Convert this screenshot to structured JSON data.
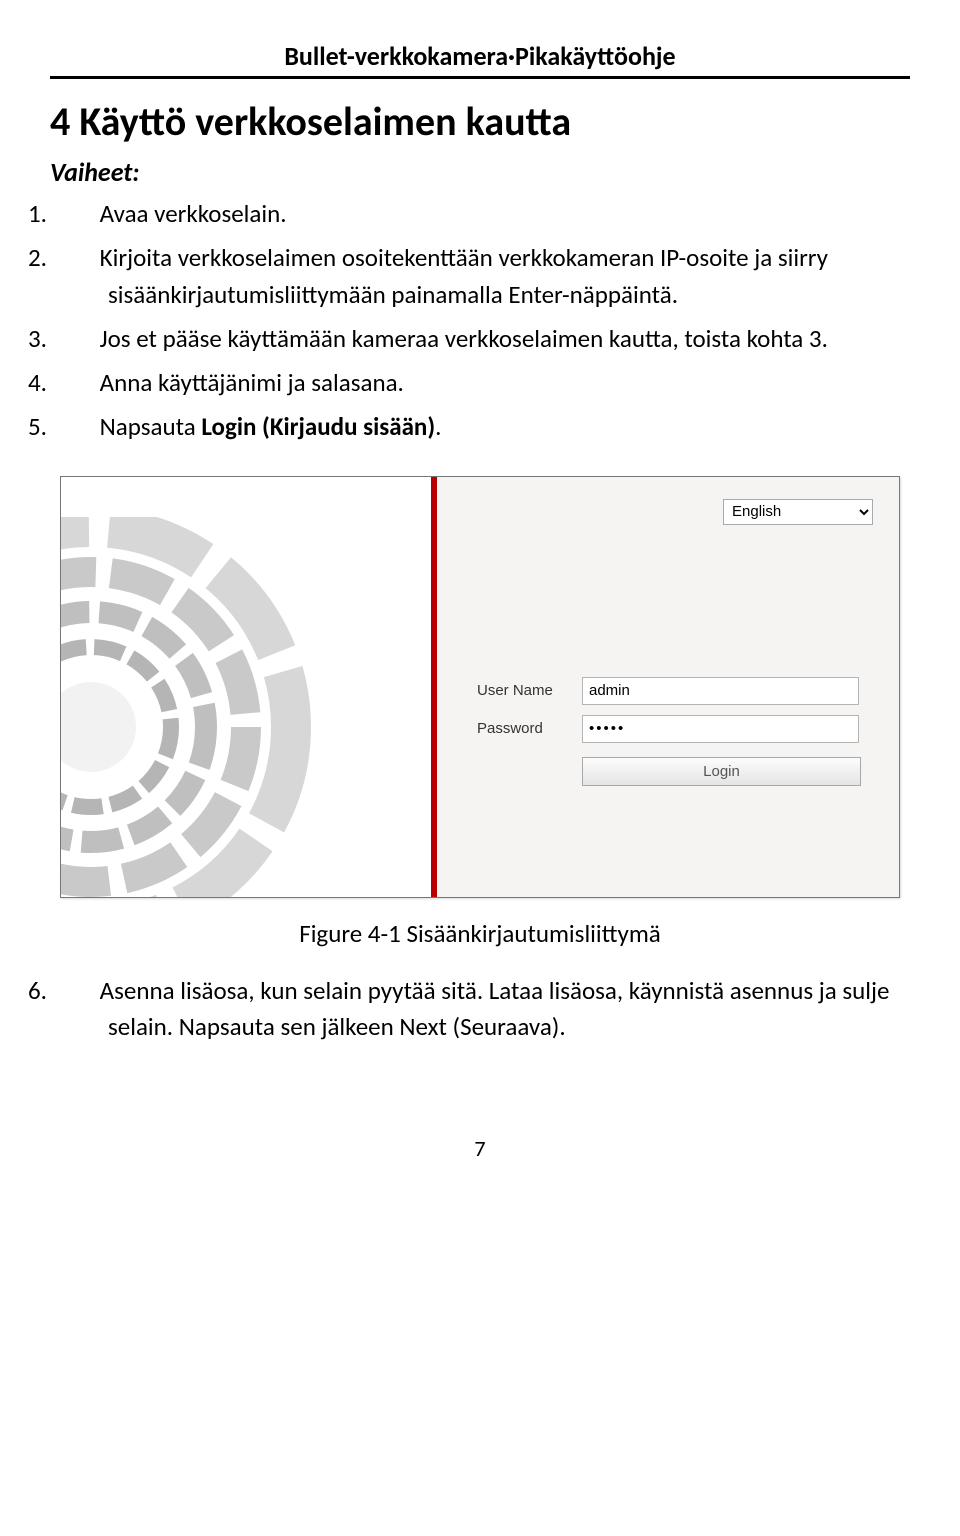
{
  "doc": {
    "header": "Bullet-verkkokamera·Pikakäyttöohje",
    "section_title": "4 Käyttö verkkoselaimen kautta",
    "steps_label": "Vaiheet:",
    "figure_caption": "Figure 4-1 Sisäänkirjautumisliittymä",
    "page_number": "7"
  },
  "steps": [
    {
      "num": "1.",
      "text": "Avaa verkkoselain."
    },
    {
      "num": "2.",
      "text": "Kirjoita verkkoselaimen osoitekenttään verkkokameran IP-osoite ja siirry sisäänkirjautumisliittymään painamalla Enter-näppäintä."
    },
    {
      "num": "3.",
      "text": "Jos et pääse käyttämään kameraa verkkoselaimen kautta, toista kohta 3."
    },
    {
      "num": "4.",
      "text": "Anna käyttäjänimi ja salasana."
    },
    {
      "num": "5.",
      "text_prefix": "Napsauta ",
      "text_bold": "Login (Kirjaudu sisään)",
      "text_suffix": "."
    },
    {
      "num": "6.",
      "text_line1": "Asenna lisäosa, kun selain pyytää sitä. Lataa lisäosa, käynnistä asennus ja sulje selain. Napsauta sen jälkeen Next (Seuraava)."
    }
  ],
  "login": {
    "language": "English",
    "username_label": "User Name",
    "username_value": "admin",
    "password_label": "Password",
    "password_value": "•••••",
    "login_button": "Login"
  }
}
